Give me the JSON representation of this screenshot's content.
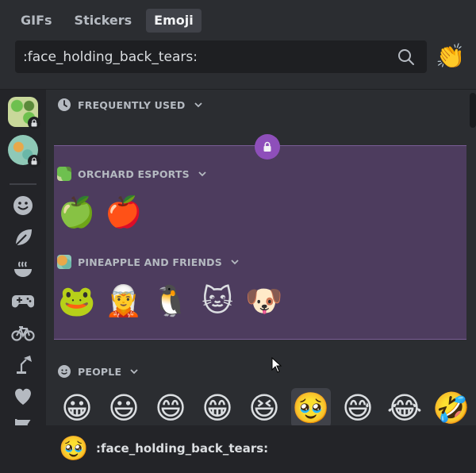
{
  "tabs": [
    {
      "label": "GIFs",
      "active": false
    },
    {
      "label": "Stickers",
      "active": false
    },
    {
      "label": "Emoji",
      "active": true
    }
  ],
  "search": {
    "value": ":face_holding_back_tears:",
    "placeholder": ":face_holding_back_tears:",
    "icon": "search-icon"
  },
  "clap_button": {
    "icon": "clapping-hands-icon",
    "glyph": "👏"
  },
  "sidebar": {
    "guilds": [
      {
        "name": "orchard-esports",
        "locked": true
      },
      {
        "name": "pineapple-and-friends",
        "locked": true
      }
    ],
    "categories": [
      {
        "icon": "smile-icon",
        "glyph": "☺"
      },
      {
        "icon": "leaf-icon",
        "glyph": "🍃"
      },
      {
        "icon": "food-bowl-icon",
        "glyph": "🍲"
      },
      {
        "icon": "gamepad-icon",
        "glyph": "🎮"
      },
      {
        "icon": "bicycle-icon",
        "glyph": "🚲"
      },
      {
        "icon": "lamp-icon",
        "glyph": "💡"
      },
      {
        "icon": "heart-icon",
        "glyph": "♥"
      },
      {
        "icon": "flag-icon",
        "glyph": "⚑"
      }
    ]
  },
  "sections": {
    "frequently_used": {
      "title": "FREQUENTLY USED"
    },
    "orchard": {
      "title": "ORCHARD ESPORTS",
      "emojis": [
        "🍏",
        "🍎"
      ]
    },
    "pineapple": {
      "title": "PINEAPPLE AND FRIENDS",
      "emojis": [
        "🐸",
        "🧝",
        "🐧",
        "🐱",
        "🐶"
      ]
    },
    "people": {
      "title": "PEOPLE",
      "emojis": [
        "😀",
        "😃",
        "😄",
        "😁",
        "😆",
        "🥹",
        "😅",
        "😂",
        "🤣"
      ],
      "selected_index": 5
    }
  },
  "footer": {
    "emoji": "🥹",
    "label": ":face_holding_back_tears:"
  },
  "colors": {
    "background": "#2b2d31",
    "sidebar": "#232428",
    "locked_block": "#4d3c5e",
    "lock_bubble": "#8e4fba"
  }
}
